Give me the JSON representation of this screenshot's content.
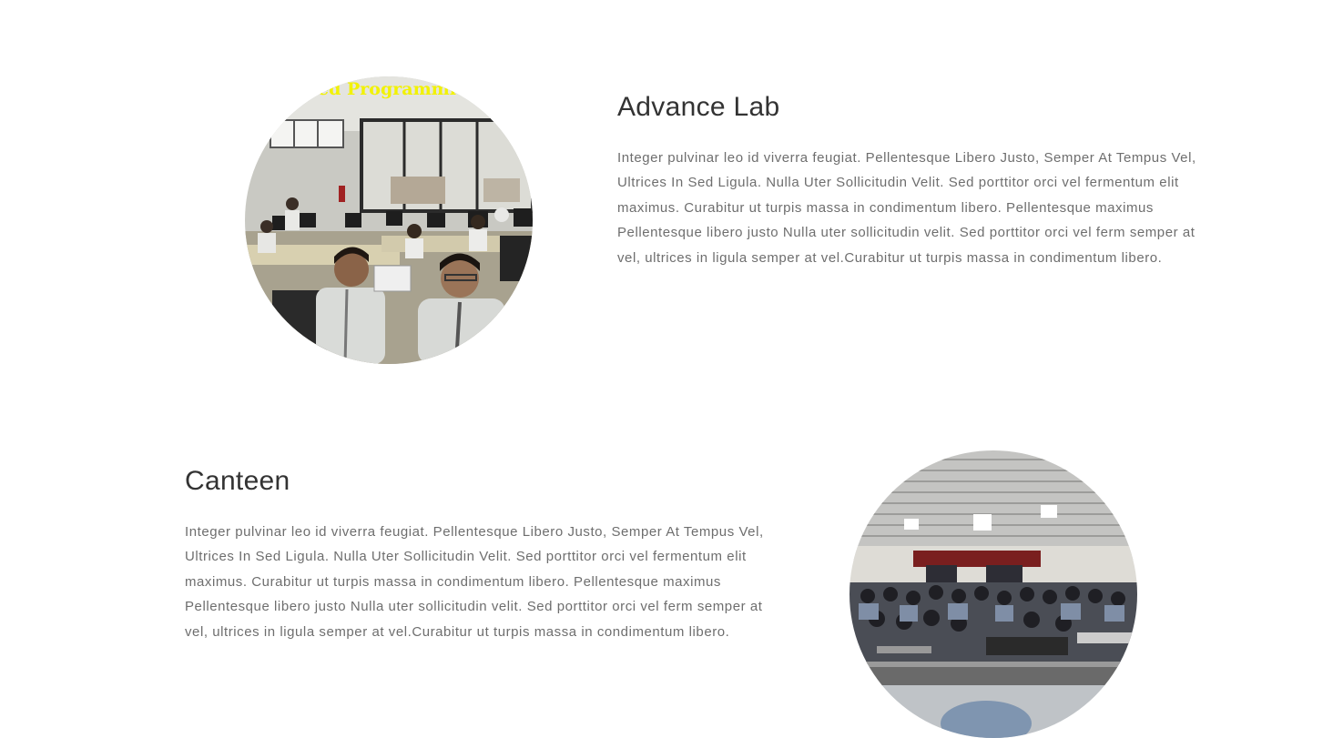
{
  "sections": [
    {
      "title": "Advance Lab",
      "description": "Integer pulvinar leo id viverra feugiat. Pellentesque Libero Justo, Semper At Tempus Vel, Ultrices In Sed Ligula. Nulla Uter Sollicitudin Velit. Sed porttitor orci vel fermentum elit maximus. Curabitur ut turpis massa in condimentum libero. Pellentesque maximus Pellentesque libero justo Nulla uter sollicitudin velit. Sed porttitor orci vel ferm semper at vel, ultrices in ligula semper at vel.Curabitur ut turpis massa in condimentum libero.",
      "image_banner_text": "ed Programmi"
    },
    {
      "title": "Canteen",
      "description": "Integer pulvinar leo id viverra feugiat. Pellentesque Libero Justo, Semper At Tempus Vel, Ultrices In Sed Ligula. Nulla Uter Sollicitudin Velit. Sed porttitor orci vel fermentum elit maximus. Curabitur ut turpis massa in condimentum libero. Pellentesque maximus Pellentesque libero justo Nulla uter sollicitudin velit. Sed porttitor orci vel ferm semper at vel, ultrices in ligula semper at vel.Curabitur ut turpis massa in condimentum libero."
    }
  ],
  "colors": {
    "heading": "#333333",
    "body": "#6e6e6e",
    "background": "#ffffff",
    "banner_text": "#f2f200"
  }
}
